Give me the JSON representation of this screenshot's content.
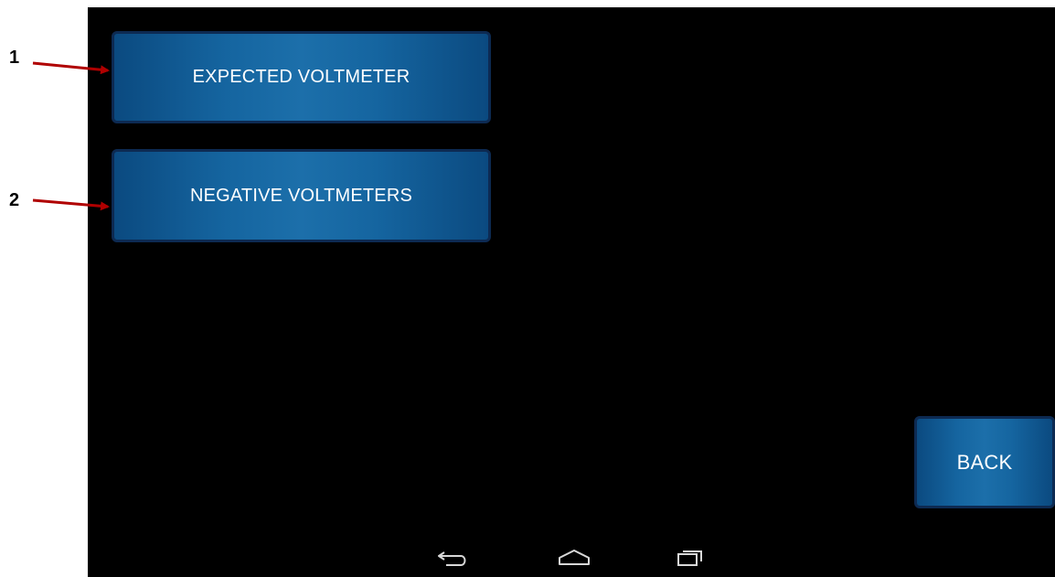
{
  "buttons": {
    "expected_label": "EXPECTED VOLTMETER",
    "negative_label": "NEGATIVE VOLTMETERS",
    "back_label": "BACK"
  },
  "callouts": {
    "one": "1",
    "two": "2"
  },
  "colors": {
    "callout_arrow": "#b00000",
    "button_blue": "#1565a0",
    "button_border": "#0d2a52",
    "screen_bg": "#000000"
  },
  "navbar": {
    "icons": [
      "back-icon",
      "home-icon",
      "recent-apps-icon"
    ]
  }
}
